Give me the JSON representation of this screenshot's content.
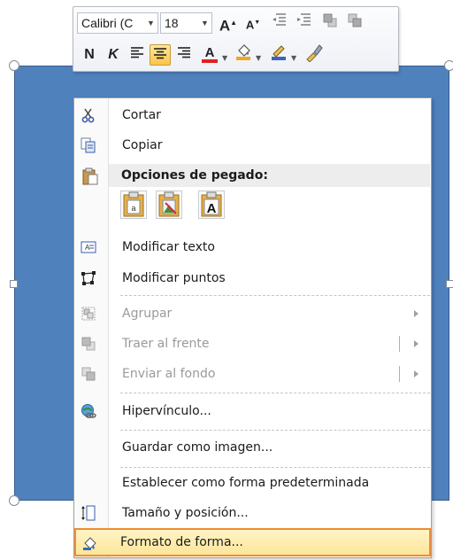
{
  "toolbar": {
    "font_name": "Calibri (C",
    "font_size": "18",
    "grow_font_icon": "A",
    "shrink_font_icon": "A",
    "bold": "N",
    "italic": "K",
    "font_color_label": "A"
  },
  "menu": {
    "items": [
      {
        "label": "Cortar",
        "icon": "scissors-icon"
      },
      {
        "label": "Copiar",
        "icon": "copy-icon"
      },
      {
        "label": "Opciones de pegado:",
        "icon": "paste-icon"
      },
      {
        "label": "Modificar texto",
        "icon": "edit-text-icon"
      },
      {
        "label": "Modificar puntos",
        "icon": "edit-points-icon"
      },
      {
        "label": "Agrupar",
        "icon": "group-icon",
        "disabled": true
      },
      {
        "label": "Traer al frente",
        "icon": "bring-front-icon",
        "disabled": true
      },
      {
        "label": "Enviar al fondo",
        "icon": "send-back-icon",
        "disabled": true
      },
      {
        "label": "Hipervínculo...",
        "icon": "hyperlink-icon"
      },
      {
        "label": "Guardar como imagen...",
        "icon": ""
      },
      {
        "label": "Establecer como forma predeterminada",
        "icon": ""
      },
      {
        "label": "Tamaño y posición...",
        "icon": "size-position-icon"
      },
      {
        "label": "Formato de forma...",
        "icon": "format-shape-icon",
        "highlighted": true
      }
    ],
    "paste_options": [
      "paste-keep-formatting",
      "paste-picture",
      "paste-text-only"
    ],
    "paste_text_only_label": "A"
  },
  "colors": {
    "shape_fill": "#4f81bd",
    "highlight_border": "#f08c32",
    "highlight_fill": "#fde69a",
    "font_color_underline": "#e02020",
    "highlight_color_underline": "#f5a623",
    "outline_color_underline": "#4060c0"
  }
}
